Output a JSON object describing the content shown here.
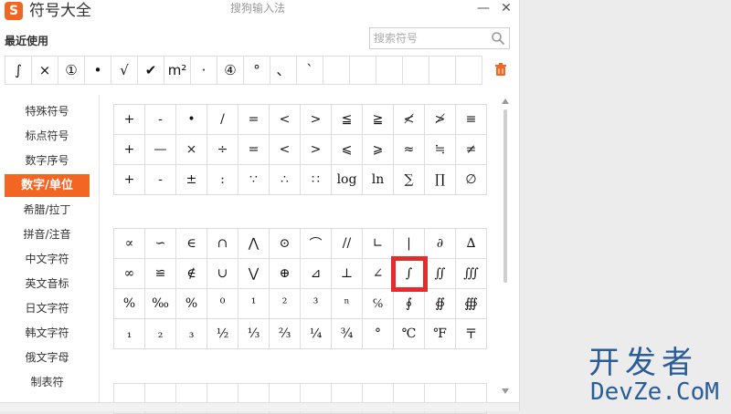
{
  "window": {
    "logo_letter": "S",
    "title": "符号大全",
    "ime_name": "搜狗输入法",
    "minimize_label": "—",
    "close_label": "✕"
  },
  "recent": {
    "label": "最近使用",
    "symbols": [
      "∫",
      "×",
      "①",
      "•",
      "√",
      "✔",
      "m²",
      "·",
      "④",
      "°",
      "、",
      "`",
      "",
      "",
      "",
      "",
      "",
      ""
    ]
  },
  "search": {
    "placeholder": "搜索符号",
    "value": ""
  },
  "sidebar": {
    "items": [
      {
        "label": "特殊符号"
      },
      {
        "label": "标点符号"
      },
      {
        "label": "数字序号"
      },
      {
        "label": "数字/单位",
        "active": true
      },
      {
        "label": "希腊/拉丁"
      },
      {
        "label": "拼音/注音"
      },
      {
        "label": "中文字符"
      },
      {
        "label": "英文音标"
      },
      {
        "label": "日文字符"
      },
      {
        "label": "韩文字符"
      },
      {
        "label": "俄文字母"
      },
      {
        "label": "制表符"
      }
    ]
  },
  "symbols": {
    "group1": [
      [
        "+",
        "-",
        "•",
        "/",
        "=",
        "<",
        ">",
        "≦",
        "≧",
        "≮",
        "≯",
        "≡"
      ],
      [
        "+",
        "—",
        "×",
        "÷",
        "=",
        "<",
        ">",
        "⩽",
        "⩾",
        "≈",
        "≒",
        "≠"
      ],
      [
        "+",
        "-",
        "±",
        ":",
        "∵",
        "∴",
        "∷",
        "log",
        "ln",
        "∑",
        "∏",
        "∅"
      ]
    ],
    "group2": [
      [
        "∝",
        "∽",
        "∈",
        "∩",
        "⋀",
        "⊙",
        "⌒",
        "//",
        "∟",
        "|",
        "∂",
        "∆"
      ],
      [
        "∞",
        "≌",
        "∉",
        "∪",
        "⋁",
        "⊕",
        "⊿",
        "⊥",
        "∠",
        "∫",
        "∬",
        "∭"
      ],
      [
        "%",
        "‰",
        "%",
        "⁰",
        "¹",
        "²",
        "³",
        "ⁿ",
        "℅",
        "∮",
        "∯",
        "∰"
      ],
      [
        "₁",
        "₂",
        "₃",
        "½",
        "⅓",
        "⅔",
        "¼",
        "¾",
        "°",
        "℃",
        "℉",
        "〒"
      ]
    ],
    "highlight": {
      "group": 2,
      "row": 1,
      "col": 9
    }
  },
  "watermark": {
    "cn": "开发者",
    "en": "DevZe.CoM"
  },
  "colors": {
    "accent": "#f26522",
    "highlight": "#e52b2b",
    "watermark": "#2a5c9a"
  }
}
